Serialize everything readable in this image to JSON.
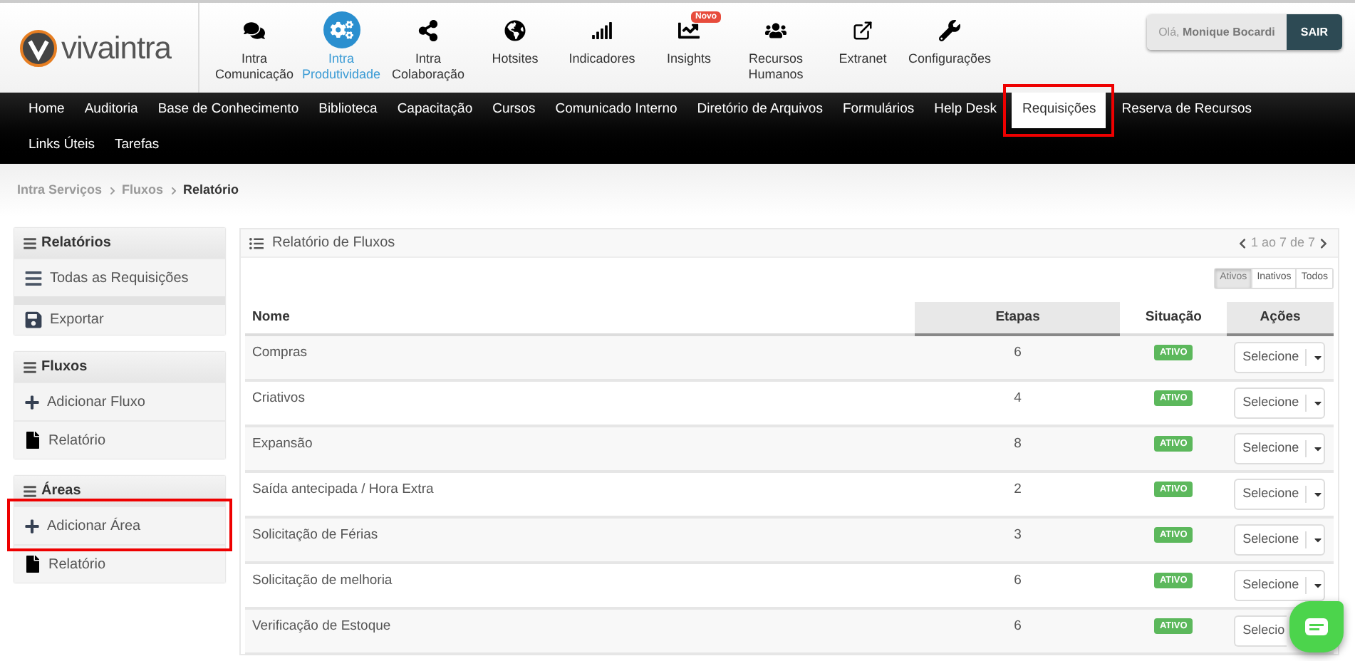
{
  "logo": {
    "text": "vivaintra"
  },
  "modules": [
    {
      "label": "Intra Comunicação",
      "selected": false
    },
    {
      "label": "Intra Produtividade",
      "selected": true
    },
    {
      "label": "Intra Colaboração",
      "selected": false
    },
    {
      "label": "Hotsites",
      "selected": false
    },
    {
      "label": "Indicadores",
      "selected": false
    },
    {
      "label": "Insights",
      "selected": false,
      "badge": "Novo"
    },
    {
      "label": "Recursos Humanos",
      "selected": false
    },
    {
      "label": "Extranet",
      "selected": false
    },
    {
      "label": "Configurações",
      "selected": false
    }
  ],
  "user": {
    "greeting": "Olá,",
    "name": "Monique Bocardi",
    "logout": "SAIR"
  },
  "nav": {
    "rows": [
      [
        {
          "label": "Home",
          "selected": false,
          "highlighted": false
        },
        {
          "label": "Auditoria",
          "selected": false,
          "highlighted": false
        },
        {
          "label": "Base de Conhecimento",
          "selected": false,
          "highlighted": false
        },
        {
          "label": "Biblioteca",
          "selected": false,
          "highlighted": false
        },
        {
          "label": "Capacitação",
          "selected": false,
          "highlighted": false
        },
        {
          "label": "Cursos",
          "selected": false,
          "highlighted": false
        },
        {
          "label": "Comunicado Interno",
          "selected": false,
          "highlighted": false
        },
        {
          "label": "Diretório de Arquivos",
          "selected": false,
          "highlighted": false
        },
        {
          "label": "Formulários",
          "selected": false,
          "highlighted": false
        },
        {
          "label": "Help Desk",
          "selected": false,
          "highlighted": false
        },
        {
          "label": "Requisições",
          "selected": true,
          "highlighted": true
        },
        {
          "label": "Reserva de Recursos",
          "selected": false,
          "highlighted": false
        }
      ],
      [
        {
          "label": "Links Úteis",
          "selected": false,
          "highlighted": false
        },
        {
          "label": "Tarefas",
          "selected": false,
          "highlighted": false
        }
      ]
    ]
  },
  "breadcrumb": [
    "Intra Serviços",
    "Fluxos",
    "Relatório"
  ],
  "sidebar": [
    {
      "title": "Relatórios",
      "items": [
        {
          "label": "Todas as Requisições",
          "kind": "list",
          "highlighted": false
        },
        {
          "label": "Exportar",
          "kind": "export",
          "highlighted": false
        }
      ]
    },
    {
      "title": "Fluxos",
      "items": [
        {
          "label": "Adicionar Fluxo",
          "kind": "add",
          "highlighted": false
        },
        {
          "label": "Relatório",
          "kind": "file",
          "highlighted": false
        }
      ]
    },
    {
      "title": "Áreas",
      "items": [
        {
          "label": "Adicionar Área",
          "kind": "add",
          "highlighted": true
        },
        {
          "label": "Relatório",
          "kind": "file",
          "highlighted": false
        }
      ]
    }
  ],
  "panel": {
    "title": "Relatório de Fluxos",
    "pagination": "1 ao 7 de 7",
    "filters": [
      {
        "label": "Ativos",
        "selected": true
      },
      {
        "label": "Inativos",
        "selected": false
      },
      {
        "label": "Todos",
        "selected": false
      }
    ],
    "table": {
      "columns": [
        "Nome",
        "Etapas",
        "Situação",
        "Ações"
      ],
      "rows": [
        {
          "name": "Compras",
          "steps": "6",
          "status": "ATIVO",
          "action": "Selecione"
        },
        {
          "name": "Criativos",
          "steps": "4",
          "status": "ATIVO",
          "action": "Selecione"
        },
        {
          "name": "Expansão",
          "steps": "8",
          "status": "ATIVO",
          "action": "Selecione"
        },
        {
          "name": "Saída antecipada / Hora Extra",
          "steps": "2",
          "status": "ATIVO",
          "action": "Selecione"
        },
        {
          "name": "Solicitação de Férias",
          "steps": "3",
          "status": "ATIVO",
          "action": "Selecione"
        },
        {
          "name": "Solicitação de melhoria",
          "steps": "6",
          "status": "ATIVO",
          "action": "Selecione"
        },
        {
          "name": "Verificação de Estoque",
          "steps": "6",
          "status": "ATIVO",
          "action": "Selecio"
        }
      ]
    }
  }
}
